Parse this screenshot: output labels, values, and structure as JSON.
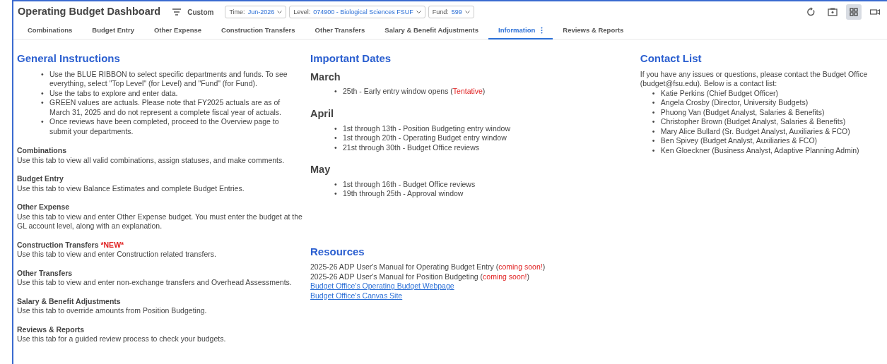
{
  "header": {
    "title": "Operating Budget Dashboard",
    "view": "Custom",
    "filters": [
      {
        "label": "Time:",
        "value": "Jun-2026"
      },
      {
        "label": "Level:",
        "value": "074900 - Biological Sciences FSUF"
      },
      {
        "label": "Fund:",
        "value": "599"
      }
    ],
    "toolbar": [
      {
        "kind": "refresh",
        "selected": false
      },
      {
        "kind": "camera",
        "selected": false
      },
      {
        "kind": "grid",
        "selected": true
      },
      {
        "kind": "video",
        "selected": false
      }
    ]
  },
  "tabs": [
    {
      "label": "Combinations",
      "selected": false
    },
    {
      "label": "Budget Entry",
      "selected": false
    },
    {
      "label": "Other Expense",
      "selected": false
    },
    {
      "label": "Construction Transfers",
      "selected": false
    },
    {
      "label": "Other Transfers",
      "selected": false
    },
    {
      "label": "Salary & Benefit Adjustments",
      "selected": false
    },
    {
      "label": "Information",
      "selected": true
    },
    {
      "label": "Reviews & Reports",
      "selected": false
    }
  ],
  "general_instructions": {
    "title": "General Instructions",
    "bullet": "•",
    "bullets": [
      "Use the BLUE RIBBON to select specific departments and funds. To see everything, select \"Top Level\" (for Level) and \"Fund\" (for Fund).",
      "Use the tabs to explore and enter data.",
      "GREEN values are actuals. Please note that FY2025 actuals are as of March 31, 2025 and do not represent a complete fiscal year of actuals.",
      "Once reviews have been completed, proceed to the Overview page to submit your departments."
    ],
    "sections": [
      {
        "title": "Combinations",
        "text": "Use this tab to view all valid combinations, assign statuses, and make comments."
      },
      {
        "title": "Budget Entry",
        "text": "Use this tab to view Balance Estimates and complete Budget Entries."
      },
      {
        "title": "Other Expense",
        "text": "Use this tab to view and enter Other Expense budget. You must enter the budget at the GL account level, along with an explanation."
      },
      {
        "title": "Construction Transfers",
        "badge": "*NEW*",
        "text": "Use this tab to view and enter Construction related transfers."
      },
      {
        "title": "Other Transfers",
        "text": "Use this tab to view and enter non-exchange transfers and Overhead Assessments."
      },
      {
        "title": "Salary & Benefit Adjustments",
        "text": "Use this tab to override amounts from Position Budgeting."
      },
      {
        "title": "Reviews & Reports",
        "text": "Use this tab for a guided review process to check your budgets."
      }
    ]
  },
  "important_dates": {
    "title": "Important Dates",
    "bullet": "•",
    "months": [
      {
        "name": "March",
        "items": [
          [
            {
              "text": "25th - Early entry window opens (",
              "kind": "plain"
            },
            {
              "text": "Tentative",
              "kind": "alert"
            },
            {
              "text": ")",
              "kind": "plain"
            }
          ]
        ]
      },
      {
        "name": "April",
        "items": [
          [
            {
              "text": "1st through 13th - Position Budgeting entry window",
              "kind": "plain"
            }
          ],
          [
            {
              "text": "1st through 20th - Operating Budget entry window",
              "kind": "plain"
            }
          ],
          [
            {
              "text": "21st through 30th - Budget Office reviews",
              "kind": "plain"
            }
          ]
        ]
      },
      {
        "name": "May",
        "items": [
          [
            {
              "text": "1st through 16th - Budget Office reviews",
              "kind": "plain"
            }
          ],
          [
            {
              "text": "19th through 25th - Approval window",
              "kind": "plain"
            }
          ]
        ]
      }
    ]
  },
  "resources": {
    "title": "Resources",
    "items": [
      {
        "kind": "text",
        "parts": [
          {
            "text": "2025-26 ADP User's Manual for Operating Budget Entry (",
            "kind": "plain"
          },
          {
            "text": "coming soon!",
            "kind": "alert"
          },
          {
            "text": ")",
            "kind": "plain"
          }
        ]
      },
      {
        "kind": "text",
        "parts": [
          {
            "text": "2025-26 ADP User's Manual for Position Budgeting (",
            "kind": "plain"
          },
          {
            "text": "coming soon!",
            "kind": "alert"
          },
          {
            "text": ")",
            "kind": "plain"
          }
        ]
      },
      {
        "kind": "link",
        "parts": [
          {
            "text": "Budget Office's Operating Budget Webpage",
            "kind": "plain"
          }
        ]
      },
      {
        "kind": "link",
        "parts": [
          {
            "text": "Budget Office's Canvas Site",
            "kind": "plain"
          }
        ]
      }
    ]
  },
  "contact_list": {
    "title": "Contact List",
    "bullet": "•",
    "intro": "If you have any issues or questions, please contact the Budget Office (budget@fsu.edu). Below is a contact list:",
    "contacts": [
      "Katie Perkins (Chief Budget Officer)",
      "Angela Crosby (Director, University Budgets)",
      "Phuong Van (Budget Analyst, Salaries & Benefits)",
      "Christopher Brown (Budget Analyst, Salaries & Benefits)",
      "Mary Alice Bullard (Sr. Budget Analyst, Auxiliaries & FCO)",
      "Ben Spivey (Budget Analyst, Auxiliaries & FCO)",
      "Ken Gloeckner (Business Analyst, Adaptive Planning Admin)"
    ]
  }
}
